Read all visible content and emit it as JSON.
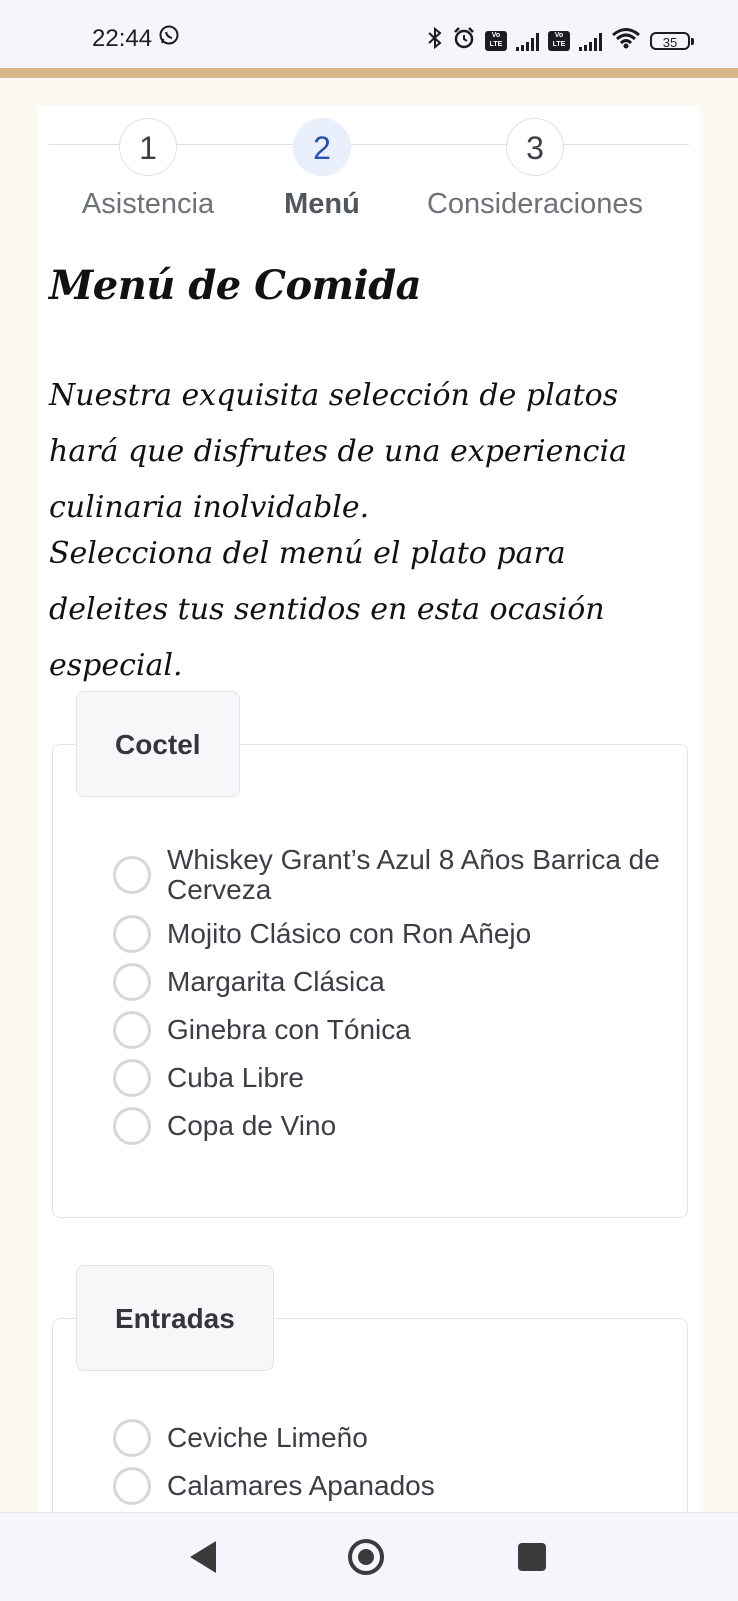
{
  "status_bar": {
    "time": "22:44",
    "battery": "35",
    "volte_label": "Vo LTE",
    "icons": [
      "whatsapp-icon",
      "bluetooth-icon",
      "alarm-icon",
      "volte-icon",
      "signal-icon",
      "volte-icon",
      "signal-icon",
      "wifi-icon",
      "battery-icon"
    ]
  },
  "stepper": {
    "steps": [
      {
        "number": "1",
        "label": "Asistencia"
      },
      {
        "number": "2",
        "label": "Menú"
      },
      {
        "number": "3",
        "label": "Consideraciones"
      }
    ],
    "active_index": 1
  },
  "content": {
    "title": "Menú de Comida",
    "intro": "Nuestra exquisita selección de platos hará que disfrutes de una experiencia culinaria inolvidable.",
    "instruction": "Selecciona del menú el plato para deleites tus sentidos en esta ocasión especial."
  },
  "groups": [
    {
      "legend": "Coctel",
      "options": [
        "Whiskey Grant’s Azul 8 Años Barrica de Cerveza",
        "Mojito Clásico con Ron Añejo",
        "Margarita Clásica",
        "Ginebra con Tónica",
        "Cuba Libre",
        "Copa de Vino"
      ]
    },
    {
      "legend": "Entradas",
      "options": [
        "Ceviche Limeño",
        "Calamares Apanados"
      ]
    }
  ],
  "colors": {
    "accent_line": "#d9b58b",
    "active_step": "#2a4fb5",
    "active_step_bg": "#e9f0fb",
    "page_bg": "#fdf8f1"
  },
  "nav_bar": {
    "icons": [
      "back-icon",
      "home-icon",
      "recent-apps-icon"
    ]
  }
}
